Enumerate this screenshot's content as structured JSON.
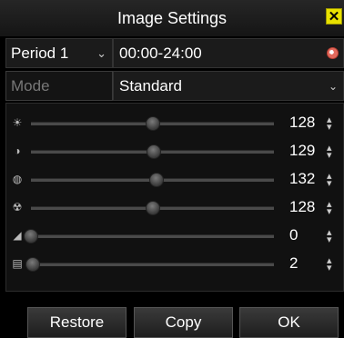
{
  "window": {
    "title": "Image Settings",
    "close_icon": "close-x-icon",
    "close_color": "#e8e100"
  },
  "schedule": {
    "period": "Period 1",
    "time_range": "00:00-24:00"
  },
  "mode": {
    "label": "Mode",
    "value": "Standard"
  },
  "sliders": [
    {
      "name": "brightness",
      "icon": "brightness-icon",
      "value": "128",
      "level": 128
    },
    {
      "name": "contrast",
      "icon": "contrast-icon",
      "value": "129",
      "level": 129
    },
    {
      "name": "saturation",
      "icon": "saturation-icon",
      "value": "132",
      "level": 132
    },
    {
      "name": "hue",
      "icon": "hue-icon",
      "value": "128",
      "level": 128
    },
    {
      "name": "sharpness",
      "icon": "sharpness-icon",
      "value": "0",
      "level": 0
    },
    {
      "name": "denoising",
      "icon": "denoising-icon",
      "value": "2",
      "level": 2
    }
  ],
  "buttons": {
    "restore": "Restore",
    "copy": "Copy",
    "ok": "OK"
  }
}
